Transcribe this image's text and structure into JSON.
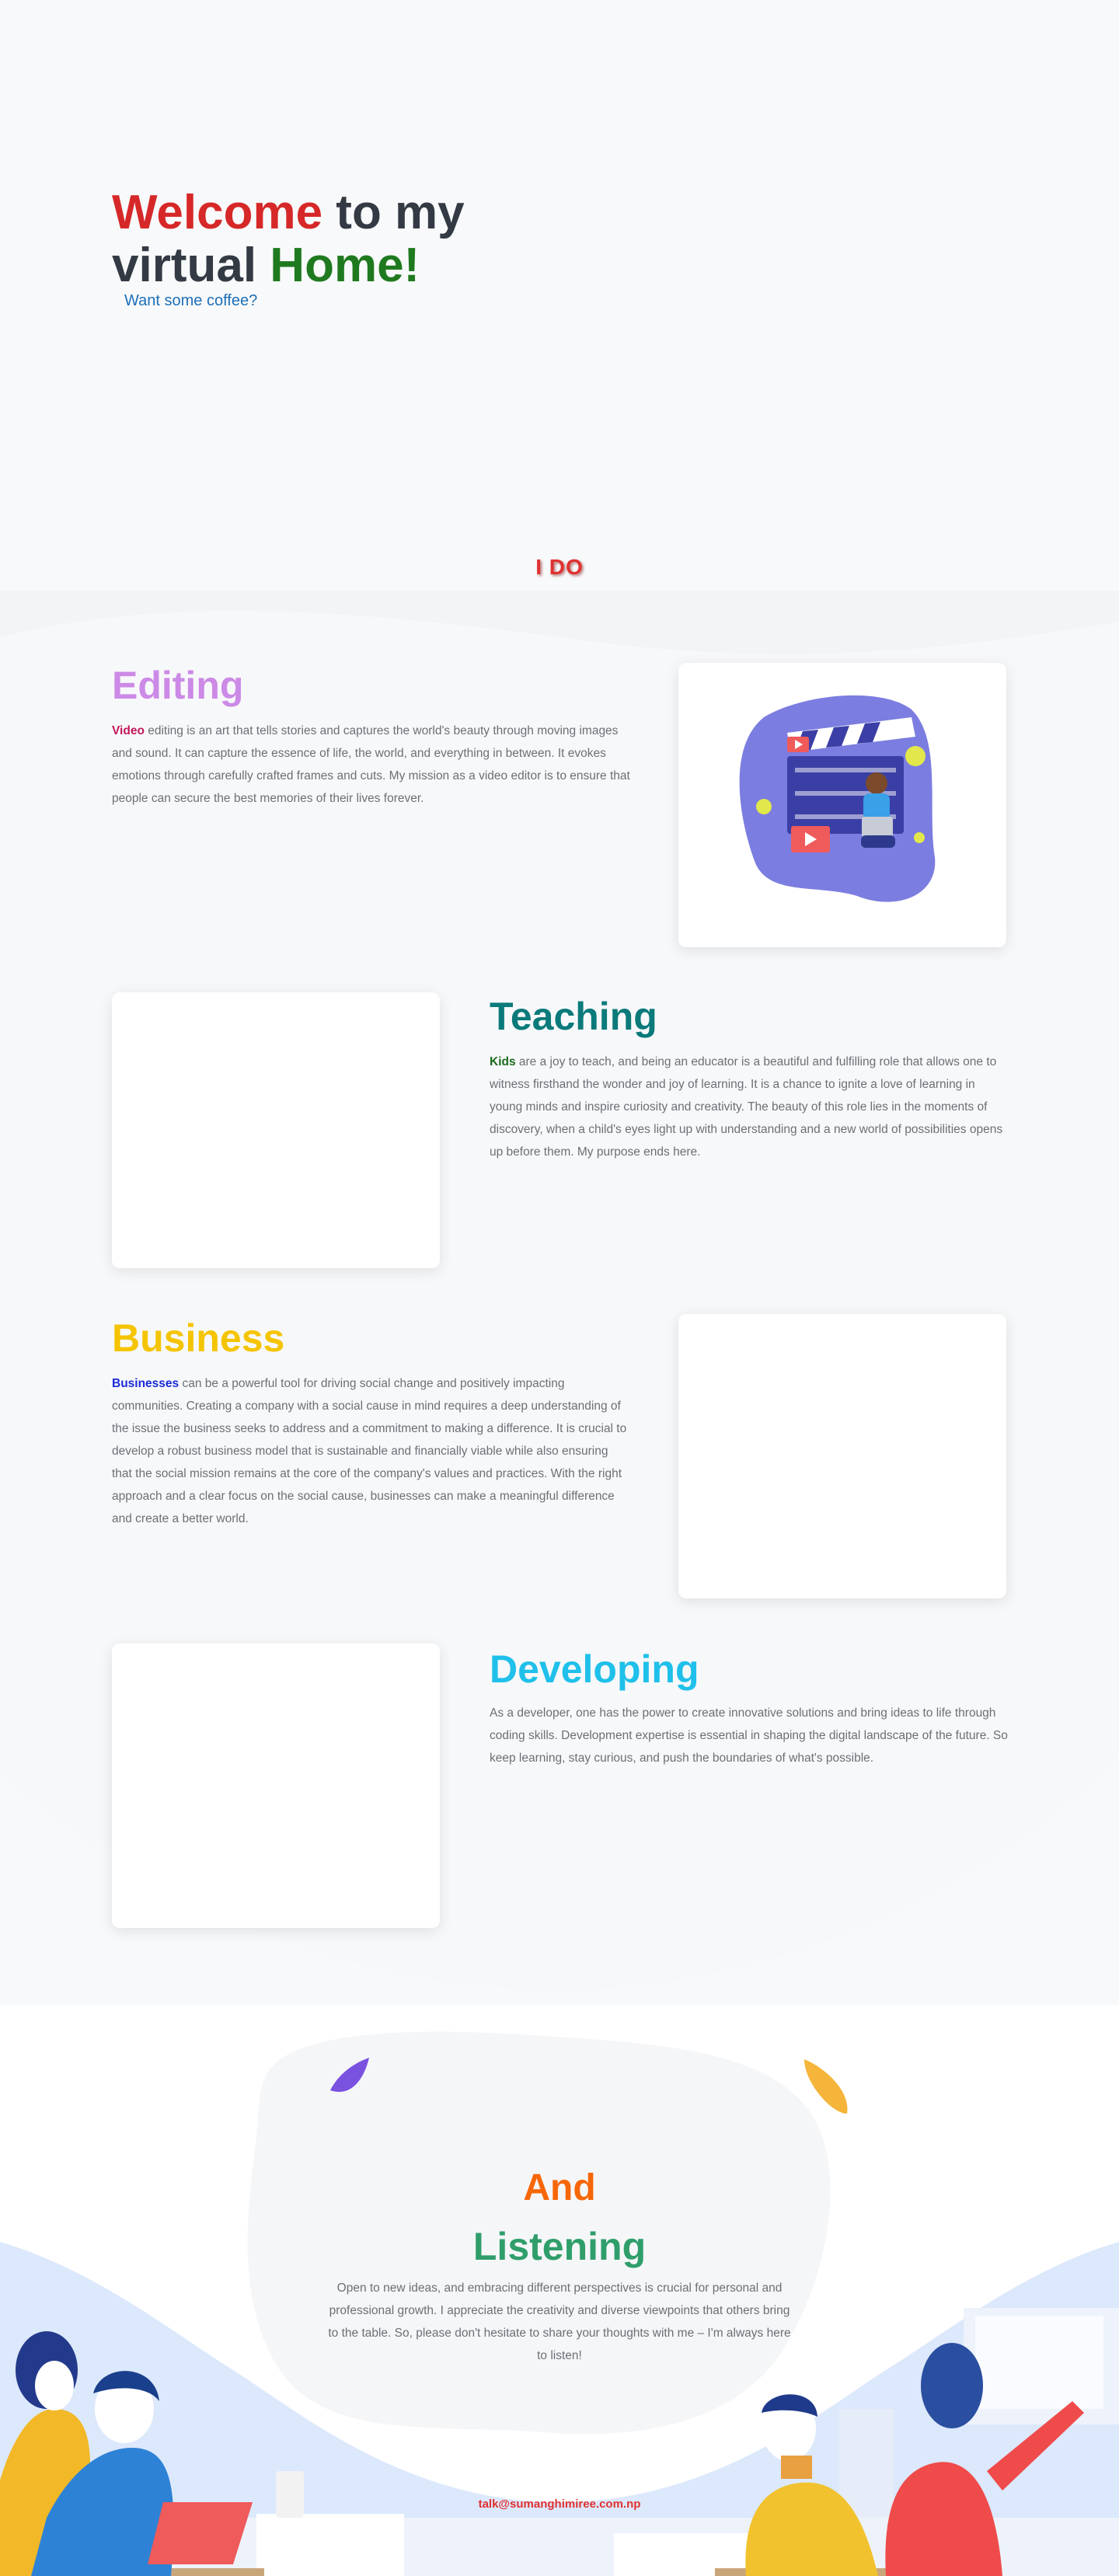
{
  "hero": {
    "title_part1": "Welcome",
    "title_part2": " to my",
    "title_part3": "virtual ",
    "title_part4": "Home!",
    "coffee_link": "Want some coffee?"
  },
  "ido_heading": "I DO",
  "services": {
    "editing": {
      "title": "Editing",
      "highlight": "Video",
      "text": " editing is an art that tells stories and captures the world's beauty through moving images and sound. It can capture the essence of life, the world, and everything in between. It evokes emotions through carefully crafted frames and cuts. My mission as a video editor is to ensure that people can secure the best memories of their lives forever."
    },
    "teaching": {
      "title": "Teaching",
      "highlight": "Kids",
      "text": " are a joy to teach, and being an educator is a beautiful and fulfilling role that allows one to witness firsthand the wonder and joy of learning. It is a chance to ignite a love of learning in young minds and inspire curiosity and creativity. The beauty of this role lies in the moments of discovery, when a child's eyes light up with understanding and a new world of possibilities opens up before them. My purpose ends here."
    },
    "business": {
      "title": "Business",
      "highlight": "Businesses",
      "text": " can be a powerful tool for driving social change and positively impacting communities. Creating a company with a social cause in mind requires a deep understanding of the issue the business seeks to address and a commitment to making a difference. It is crucial to develop a robust business model that is sustainable and financially viable while also ensuring that the social mission remains at the core of the company's values and practices. With the right approach and a clear focus on the social cause, businesses can make a meaningful difference and create a better world."
    },
    "developing": {
      "title": "Developing",
      "text": "As a developer, one has the power to create innovative solutions and bring ideas to life through coding skills. Development expertise is essential in shaping the digital landscape of the future. So keep learning, stay curious, and push the boundaries of what's possible."
    }
  },
  "listening": {
    "title_line1": "And",
    "title_line2": "Listening",
    "text": "Open to new ideas, and embracing different perspectives is crucial for personal and professional growth. I appreciate the creativity and diverse viewpoints that others bring to the table. So, please don't hesitate to share your thoughts with me – I'm always here to listen!",
    "email": "talk@sumanghimiree.com.np"
  },
  "colors": {
    "welcome": "#d62828",
    "home": "#1f7a1f",
    "editing": "#cc8ae6",
    "teaching": "#0b7a7a",
    "business": "#f5c400",
    "developing": "#1fc0ea",
    "and": "#f76707",
    "listening": "#2f9e6b",
    "email": "#e03131"
  }
}
